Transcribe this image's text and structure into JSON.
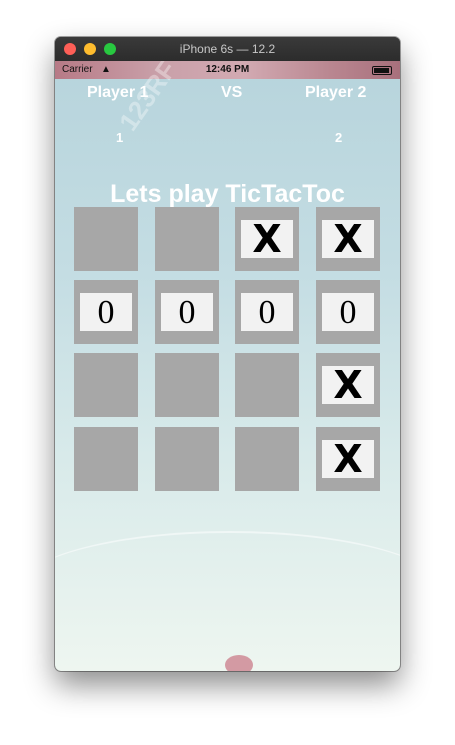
{
  "window": {
    "title": "iPhone 6s — 12.2"
  },
  "status": {
    "carrier": "Carrier",
    "time": "12:46 PM"
  },
  "watermark": "123RF",
  "game": {
    "player1_label": "Player 1",
    "vs_label": "VS",
    "player2_label": "Player 2",
    "player1_score": "1",
    "player2_score": "2",
    "title": "Lets play TicTacToc"
  },
  "board": {
    "rows": [
      [
        "",
        "",
        "X",
        "X"
      ],
      [
        "0",
        "0",
        "0",
        "0"
      ],
      [
        "",
        "",
        "",
        "X"
      ],
      [
        "",
        "",
        "",
        "X"
      ]
    ]
  },
  "colors": {
    "cell": "#a7a7a7",
    "mark_bg": "#f2f2f2",
    "text": "#ffffff"
  }
}
